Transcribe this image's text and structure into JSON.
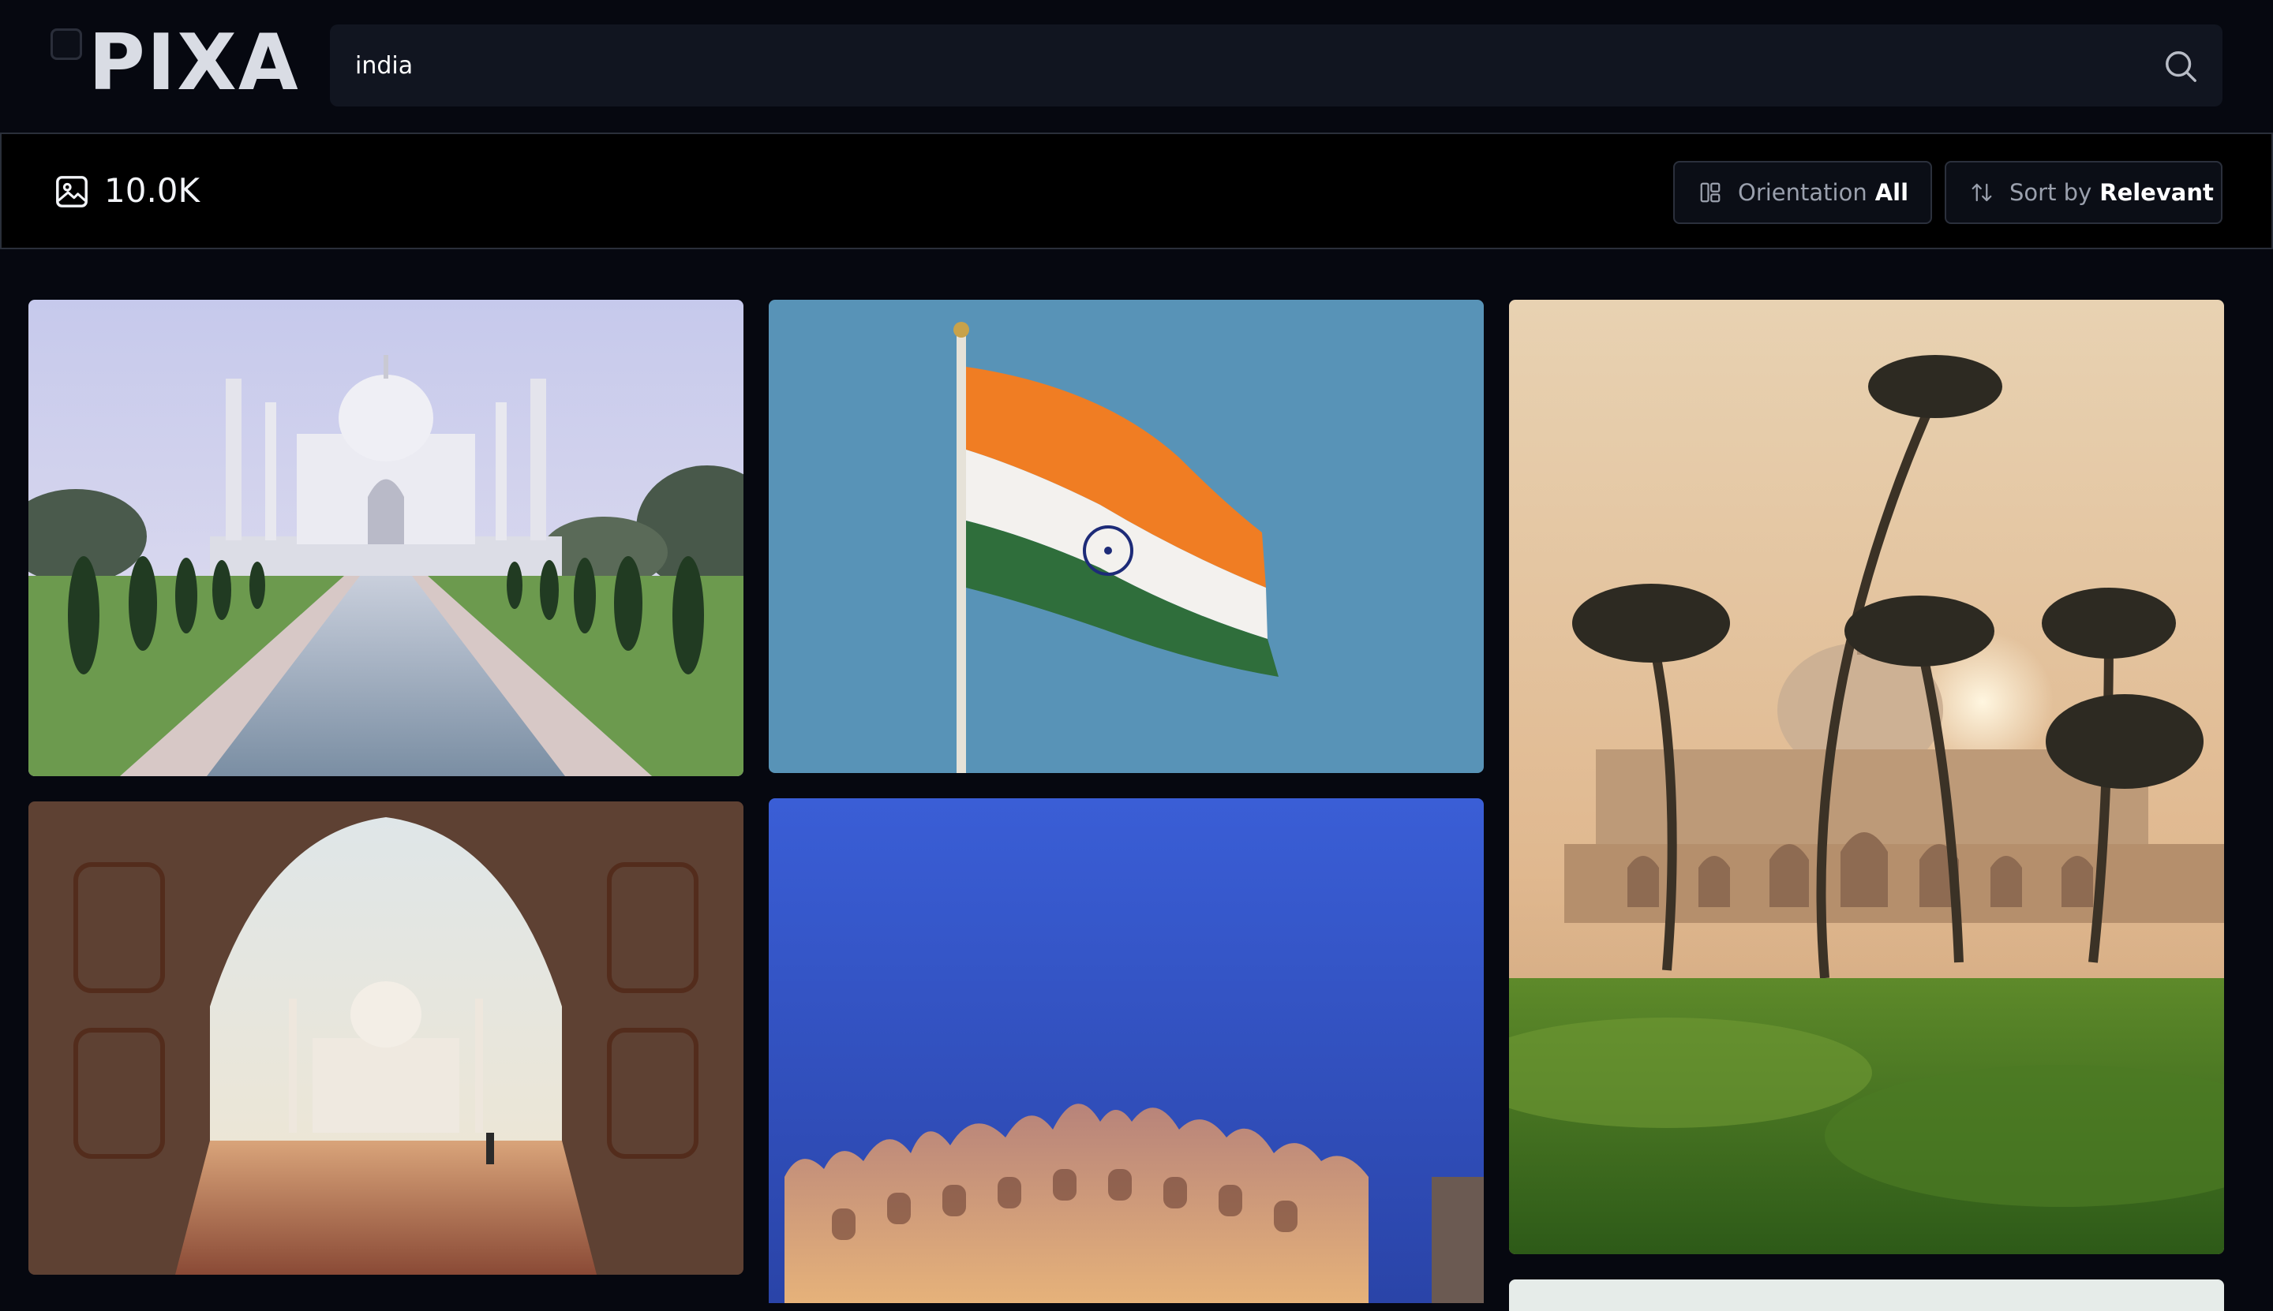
{
  "brand": {
    "logo_text": "PIXA"
  },
  "search": {
    "query": "india",
    "placeholder": ""
  },
  "results": {
    "count": "10.0K",
    "orientation": {
      "label": "Orientation",
      "value": "All"
    },
    "sort": {
      "label": "Sort by",
      "value": "Relevant"
    }
  },
  "icons": {
    "menu": "menu-toggle-icon",
    "search": "search-icon",
    "count": "image-icon",
    "orientation": "layout-icon",
    "sort": "sort-arrows-icon"
  },
  "colors": {
    "background": "#060810",
    "results_bar": "#000000",
    "search_field": "#111520",
    "pill_border": "#2b303c",
    "text_primary": "#ffffff",
    "text_muted": "#9aa0ad"
  },
  "gallery": {
    "photos": [
      {
        "subject": "taj-mahal-reflecting-pool"
      },
      {
        "subject": "indian-flag"
      },
      {
        "subject": "humayuns-tomb-palms"
      },
      {
        "subject": "taj-mahal-through-arch"
      },
      {
        "subject": "hawa-mahal-night"
      },
      {
        "subject": "partial-image"
      }
    ]
  }
}
